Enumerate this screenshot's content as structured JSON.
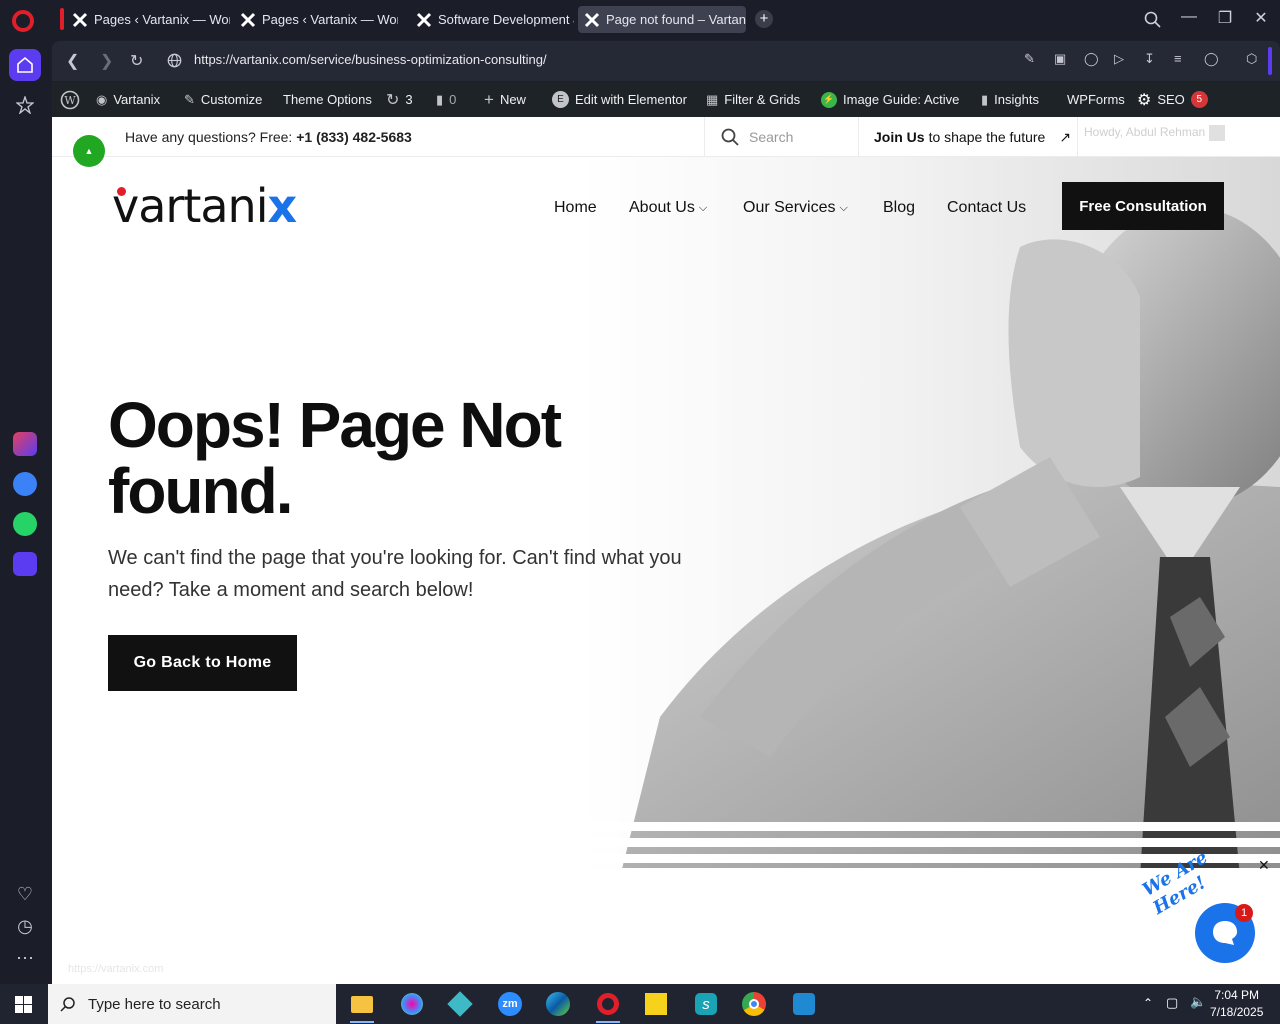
{
  "browser": {
    "tabs": [
      {
        "title": "Pages ‹ Vartanix — WordP"
      },
      {
        "title": "Pages ‹ Vartanix — WordP"
      },
      {
        "title": "Software Development &"
      },
      {
        "title": "Page not found – Vartanix"
      }
    ],
    "url": "https://vartanix.com/service/business-optimization-consulting/"
  },
  "wpbar": {
    "site": "Vartanix",
    "customize": "Customize",
    "theme_options": "Theme Options",
    "updates": "3",
    "comments": "0",
    "new": "New",
    "elementor": "Edit with Elementor",
    "filter": "Filter & Grids",
    "image_guide": "Image Guide: Active",
    "insights": "Insights",
    "wpforms": "WPForms",
    "seo": "SEO",
    "seo_count": "5"
  },
  "topbar": {
    "question": "Have any questions? Free: ",
    "phone": "+1 (833) 482-5683",
    "search_placeholder": "Search",
    "join_bold": "Join Us",
    "join_rest": " to shape the future",
    "howdy": "Howdy, Abdul Rehman"
  },
  "header": {
    "logo": "vartani",
    "logo_x": "x",
    "nav": [
      "Home",
      "About Us",
      "Our Services",
      "Blog",
      "Contact Us"
    ],
    "cta": "Free Consultation"
  },
  "hero": {
    "headline": "Oops! Page Not found.",
    "subtext": "We can't find the page that you're looking for. Can't find what you need? Take a moment and search below!",
    "button": "Go Back to Home"
  },
  "chat": {
    "badge": "1",
    "tagline": "We Are Here!"
  },
  "status_url": "https://vartanix.com",
  "taskbar": {
    "search_placeholder": "Type here to search",
    "time": "7:04 PM",
    "date": "7/18/2025"
  },
  "colors": {
    "accent_blue": "#1a73e8",
    "brand_red": "#e01f2b",
    "dark": "#111111"
  }
}
